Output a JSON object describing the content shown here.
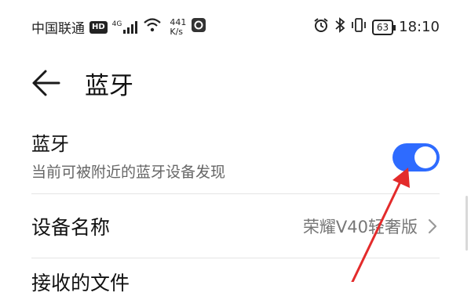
{
  "status_bar": {
    "carrier": "中国联通",
    "hd_badge": "HD",
    "network_type": "4G",
    "net_speed_value": "441",
    "net_speed_unit": "K/s",
    "battery_level": "63",
    "time": "18:10",
    "icons": [
      "hd-icon",
      "cellular-signal-icon",
      "wifi-icon",
      "app-notification-icon",
      "alarm-icon",
      "bluetooth-icon",
      "vibrate-icon",
      "battery-icon"
    ]
  },
  "header": {
    "back_icon": "back-arrow-icon",
    "title": "蓝牙"
  },
  "bluetooth_row": {
    "title": "蓝牙",
    "subtitle": "当前可被附近的蓝牙设备发现",
    "toggle_state": "on",
    "toggle_color": "#2e6bff"
  },
  "device_name_row": {
    "label": "设备名称",
    "value": "荣耀V40轻奢版",
    "chevron_icon": "chevron-right-icon"
  },
  "next_row": {
    "label": "接收的文件"
  },
  "annotation": {
    "arrow_color": "#e32b2b"
  }
}
